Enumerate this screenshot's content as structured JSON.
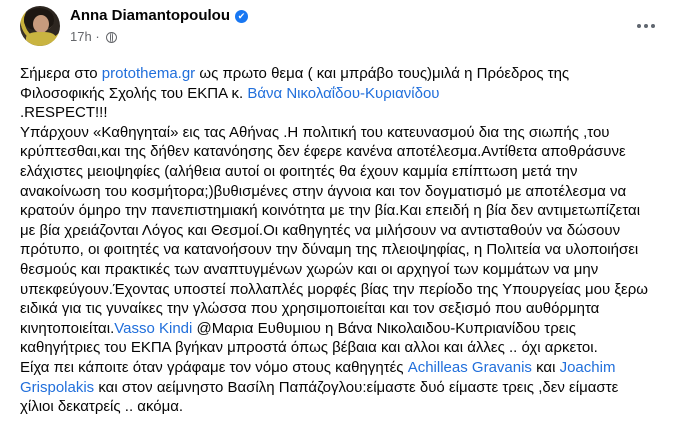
{
  "author": {
    "name": "Anna Diamantopoulou",
    "verified_mark": "✔",
    "time": "17h",
    "separator": "·",
    "audience_icon": "globe-icon"
  },
  "menu_icon": "more-icon",
  "post": {
    "lines": [
      {
        "segments": [
          {
            "text": "Σήμερα στο "
          },
          {
            "text": "protothema.gr",
            "link": true
          },
          {
            "text": "  ως πρωτο θεμα ( και μπράβο τους)μιλά η Πρόεδρος της"
          }
        ]
      },
      {
        "segments": [
          {
            "text": "Φιλοσοφικής Σχολής του ΕΚΠΑ κ. "
          },
          {
            "text": "Βάνα Νικολαΐδου-Κυριανίδου",
            "link": true
          }
        ]
      },
      {
        "segments": [
          {
            "text": " .RESPECT!!!"
          }
        ]
      },
      {
        "segments": [
          {
            "text": "Υπάρχουν «Καθηγηταί» εις τας Αθήνας .Η πολιτική του κατευνασμού δια της σιωπής ,του"
          }
        ]
      },
      {
        "segments": [
          {
            "text": "κρύπτεσθαι,και της δήθεν κατανόησης δεν έφερε κανένα αποτέλεσμα.Αντίθετα αποθράσυνε"
          }
        ]
      },
      {
        "segments": [
          {
            "text": "ελάχιστες μειοψηφίες (αλήθεια αυτοί οι φοιτητές θα έχουν καμμία επίπτωση μετά την"
          }
        ]
      },
      {
        "segments": [
          {
            "text": "ανακοίνωση του κοσμήτορα;)βυθισμένες στην άγνοια και τον δογματισμό με αποτέλεσμα να"
          }
        ]
      },
      {
        "segments": [
          {
            "text": "κρατούν όμηρο την πανεπιστημιακή κοινότητα με την βία.Και επειδή η βία δεν αντιμετωπίζεται"
          }
        ]
      },
      {
        "segments": [
          {
            "text": "με βία χρειάζονται Λόγος και Θεσμοί.Οι καθηγητές να μιλήσουν να αντισταθούν να δώσουν"
          }
        ]
      },
      {
        "segments": [
          {
            "text": "πρότυπο, οι φοιτητές να κατανοήσουν την δύναμη της πλειοψηφίας, η Πολιτεία να υλοποιήσει"
          }
        ]
      },
      {
        "segments": [
          {
            "text": "θεσμούς και πρακτικές των αναπτυγμένων χωρών και οι αρχηγοί των κομμάτων να  μην"
          }
        ]
      },
      {
        "segments": [
          {
            "text": "υπεκφεύγουν.Έχοντας υποστεί πολλαπλές μορφές βίας την περίοδο της Υπουργείας μου ξερω"
          }
        ]
      },
      {
        "segments": [
          {
            "text": "ειδικά για τις γυναίκες την γλώσσα που χρησιμοποιείται και τον σεξισμό που αυθόρμητα"
          }
        ]
      },
      {
        "segments": [
          {
            "text": "κινητοποιείται."
          },
          {
            "text": "Vasso Kindi",
            "link": true
          },
          {
            "text": " @Μαρια Ευθυμιου η Βάνα Νικολαιδου-Κυπριανίδου τρεις"
          }
        ]
      },
      {
        "segments": [
          {
            "text": "καθηγήτριες του ΕΚΠΑ βγήκαν μπροστά όπως βέβαια και αλλοι και άλλες .. όχι αρκετοι."
          }
        ]
      },
      {
        "segments": [
          {
            "text": "Είχα πει κάποιτε όταν γράφαμε τον νόμο στους καθηγητές "
          },
          {
            "text": "Achilleas Gravanis",
            "link": true
          },
          {
            "text": " και "
          },
          {
            "text": "Joachim",
            "link": true
          }
        ]
      },
      {
        "segments": [
          {
            "text": "Grispolakis",
            "link": true
          },
          {
            "text": "  και στον αείμνηστο Βασίλη Παπάζογλου:είμαστε δυό είμαστε τρεις ,δεν είμαστε"
          }
        ]
      },
      {
        "segments": [
          {
            "text": "χίλιοι δεκατρείς .. ακόμα."
          }
        ]
      }
    ]
  },
  "colors": {
    "link": "#216fdb",
    "text": "#050505",
    "meta": "#65676b",
    "verified": "#1877f2"
  }
}
